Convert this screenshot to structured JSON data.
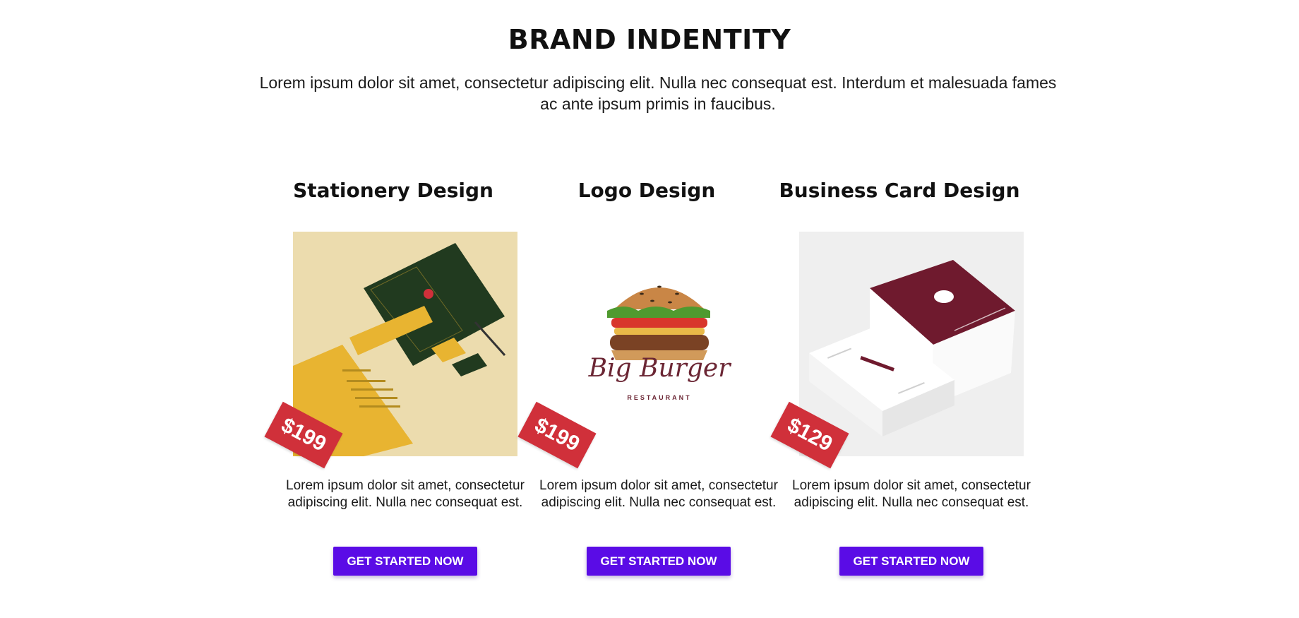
{
  "section": {
    "title": "BRAND INDENTITY",
    "intro": "Lorem ipsum dolor sit amet, consectetur adipiscing elit. Nulla nec consequat est. Interdum et malesuada fames ac ante ipsum primis in faucibus."
  },
  "cards": [
    {
      "title": "Stationery Design",
      "price": "$199",
      "description": "Lorem ipsum dolor sit amet, consectetur adipiscing elit. Nulla nec consequat est.",
      "cta": "GET STARTED NOW"
    },
    {
      "title": "Logo Design",
      "price": "$199",
      "description": "Lorem ipsum dolor sit amet, consectetur adipiscing elit. Nulla nec consequat est.",
      "cta": "GET STARTED NOW",
      "logo": {
        "name": "Big Burger",
        "tagline": "RESTAURANT"
      }
    },
    {
      "title": "Business Card Design",
      "price": "$129",
      "description": "Lorem ipsum dolor sit amet, consectetur adipiscing elit. Nulla nec consequat est.",
      "cta": "GET STARTED NOW"
    }
  ],
  "colors": {
    "accent": "#5a0ce6",
    "price_tag": "#d0303a",
    "stationery_bg": "#ecdcae",
    "stationery_green": "#213a1f",
    "stationery_yellow": "#e8b431",
    "card_maroon": "#6f1a2e"
  }
}
